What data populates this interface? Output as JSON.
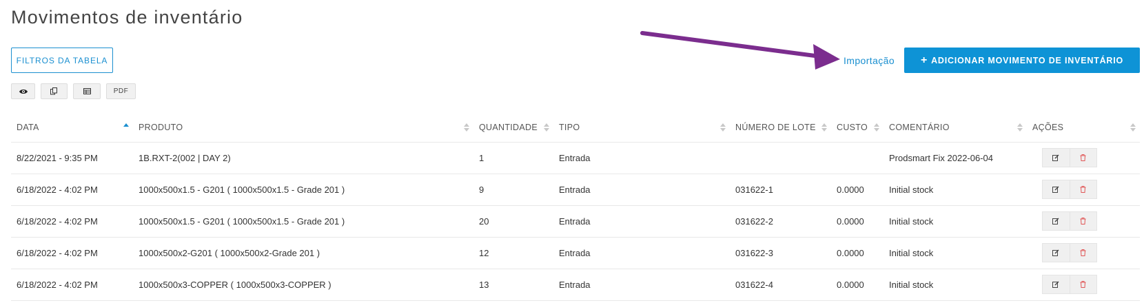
{
  "header": {
    "title": "Movimentos de inventário",
    "filters_label": "FILTROS DA TABELA",
    "import_label": "Importação",
    "add_label": "ADICIONAR MOVIMENTO DE INVENTÁRIO",
    "add_icon": "plus-icon"
  },
  "tools": [
    {
      "name": "view-columns",
      "icon": "eye-icon",
      "label": ""
    },
    {
      "name": "copy",
      "icon": "copy-icon",
      "label": ""
    },
    {
      "name": "excel",
      "icon": "table-icon",
      "label": ""
    },
    {
      "name": "pdf",
      "icon": "",
      "label": "PDF"
    }
  ],
  "colors": {
    "accent": "#1a8fd0",
    "primary_button": "#0e93d6",
    "arrow": "#7b2d8e",
    "delete": "#e05555"
  },
  "table": {
    "columns": [
      "DATA",
      "PRODUTO",
      "QUANTIDADE",
      "TIPO",
      "NÚMERO DE LOTE",
      "CUSTO",
      "COMENTÁRIO",
      "AÇÕES"
    ],
    "sorted_column": "DATA",
    "rows": [
      {
        "data": "8/22/2021 - 9:35 PM",
        "produto": "1B.RXT-2(002 | DAY 2)",
        "quantidade": "1",
        "tipo": "Entrada",
        "lote": "",
        "custo": "",
        "comentario": "Prodsmart Fix 2022-06-04"
      },
      {
        "data": "6/18/2022 - 4:02 PM",
        "produto": "1000x500x1.5 - G201 ( 1000x500x1.5 - Grade 201 )",
        "quantidade": "9",
        "tipo": "Entrada",
        "lote": "031622-1",
        "custo": "0.0000",
        "comentario": "Initial stock"
      },
      {
        "data": "6/18/2022 - 4:02 PM",
        "produto": "1000x500x1.5 - G201 ( 1000x500x1.5 - Grade 201 )",
        "quantidade": "20",
        "tipo": "Entrada",
        "lote": "031622-2",
        "custo": "0.0000",
        "comentario": "Initial stock"
      },
      {
        "data": "6/18/2022 - 4:02 PM",
        "produto": "1000x500x2-G201 ( 1000x500x2-Grade 201 )",
        "quantidade": "12",
        "tipo": "Entrada",
        "lote": "031622-3",
        "custo": "0.0000",
        "comentario": "Initial stock"
      },
      {
        "data": "6/18/2022 - 4:02 PM",
        "produto": "1000x500x3-COPPER ( 1000x500x3-COPPER )",
        "quantidade": "13",
        "tipo": "Entrada",
        "lote": "031622-4",
        "custo": "0.0000",
        "comentario": "Initial stock"
      }
    ],
    "row_actions": [
      {
        "name": "edit",
        "icon": "edit-icon"
      },
      {
        "name": "delete",
        "icon": "trash-icon"
      }
    ]
  }
}
